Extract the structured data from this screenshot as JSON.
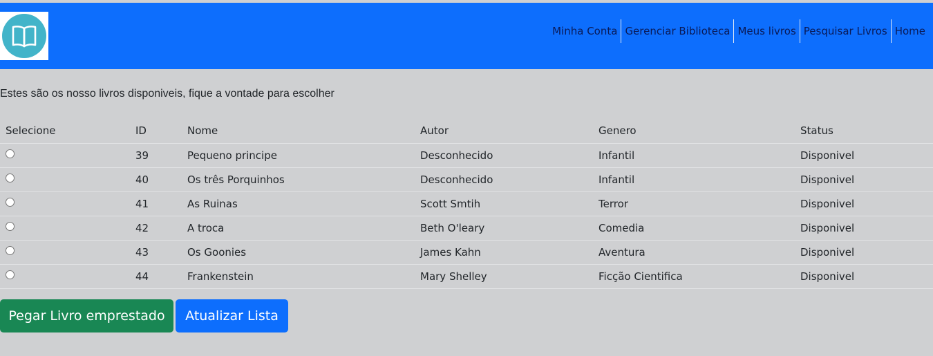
{
  "colors": {
    "navbar": "#0d6efd",
    "page_background": "#cfd0d2",
    "logo_circle": "#42b4c9",
    "nav_link": "#0a1a57",
    "success_button": "#198754",
    "primary_button": "#0d6efd"
  },
  "logo": {
    "icon": "open-book-icon"
  },
  "nav": {
    "items": [
      {
        "label": "Minha Conta"
      },
      {
        "label": "Gerenciar Biblioteca"
      },
      {
        "label": "Meus livros"
      },
      {
        "label": "Pesquisar Livros"
      },
      {
        "label": "Home"
      }
    ]
  },
  "intro_text": "Estes são os nosso livros disponiveis, fique a vontade para escolher",
  "table": {
    "headers": [
      "Selecione",
      "ID",
      "Nome",
      "Autor",
      "Genero",
      "Status"
    ],
    "rows": [
      {
        "id": "39",
        "nome": "Pequeno principe",
        "autor": "Desconhecido",
        "genero": "Infantil",
        "status": "Disponivel"
      },
      {
        "id": "40",
        "nome": "Os três Porquinhos",
        "autor": "Desconhecido",
        "genero": "Infantil",
        "status": "Disponivel"
      },
      {
        "id": "41",
        "nome": "As Ruinas",
        "autor": "Scott Smtih",
        "genero": "Terror",
        "status": "Disponivel"
      },
      {
        "id": "42",
        "nome": "A troca",
        "autor": "Beth O'leary",
        "genero": "Comedia",
        "status": "Disponivel"
      },
      {
        "id": "43",
        "nome": "Os Goonies",
        "autor": "James Kahn",
        "genero": "Aventura",
        "status": "Disponivel"
      },
      {
        "id": "44",
        "nome": "Frankenstein",
        "autor": "Mary Shelley",
        "genero": "Ficção Cientifica",
        "status": "Disponivel"
      }
    ]
  },
  "buttons": {
    "borrow": "Pegar Livro emprestado",
    "refresh": "Atualizar Lista"
  }
}
